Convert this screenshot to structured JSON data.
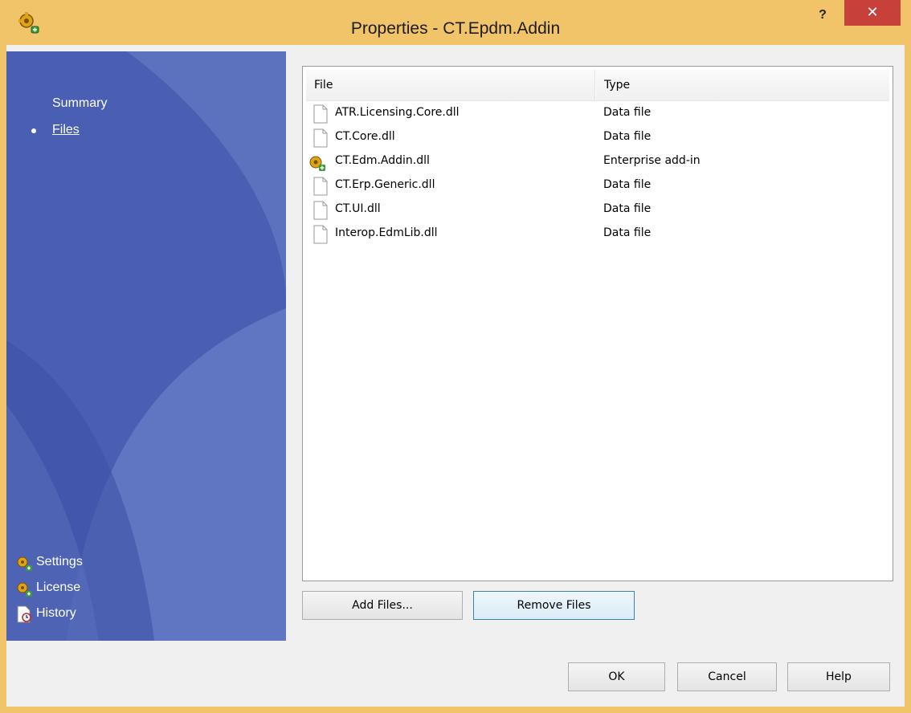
{
  "window": {
    "title": "Properties - CT.Epdm.Addin",
    "help_glyph": "?",
    "close_glyph": "✕",
    "app_icon": "addin-gear-icon"
  },
  "sidebar": {
    "top_items": [
      {
        "label": "Summary",
        "selected": false
      },
      {
        "label": "Files",
        "selected": true
      }
    ],
    "bottom_items": [
      {
        "label": "Settings",
        "icon": "addin-gear-icon"
      },
      {
        "label": "License",
        "icon": "addin-gear-icon"
      },
      {
        "label": "History",
        "icon": "history-document-icon"
      }
    ]
  },
  "file_list": {
    "columns": [
      "File",
      "Type"
    ],
    "rows": [
      {
        "name": "ATR.Licensing.Core.dll",
        "type": "Data file",
        "icon": "blank-file-icon"
      },
      {
        "name": "CT.Core.dll",
        "type": "Data file",
        "icon": "blank-file-icon"
      },
      {
        "name": "CT.Edm.Addin.dll",
        "type": "Enterprise add-in",
        "icon": "addin-gear-icon"
      },
      {
        "name": "CT.Erp.Generic.dll",
        "type": "Data file",
        "icon": "blank-file-icon"
      },
      {
        "name": "CT.UI.dll",
        "type": "Data file",
        "icon": "blank-file-icon"
      },
      {
        "name": "Interop.EdmLib.dll",
        "type": "Data file",
        "icon": "blank-file-icon"
      }
    ]
  },
  "actions": {
    "add_files": "Add Files...",
    "remove_files": "Remove Files",
    "ok": "OK",
    "cancel": "Cancel",
    "help": "Help"
  },
  "colors": {
    "title_bar": "#f2c46a",
    "close_button": "#c7403a",
    "sidebar": "#4a5fb3",
    "focus_border": "#3c7fb1"
  }
}
